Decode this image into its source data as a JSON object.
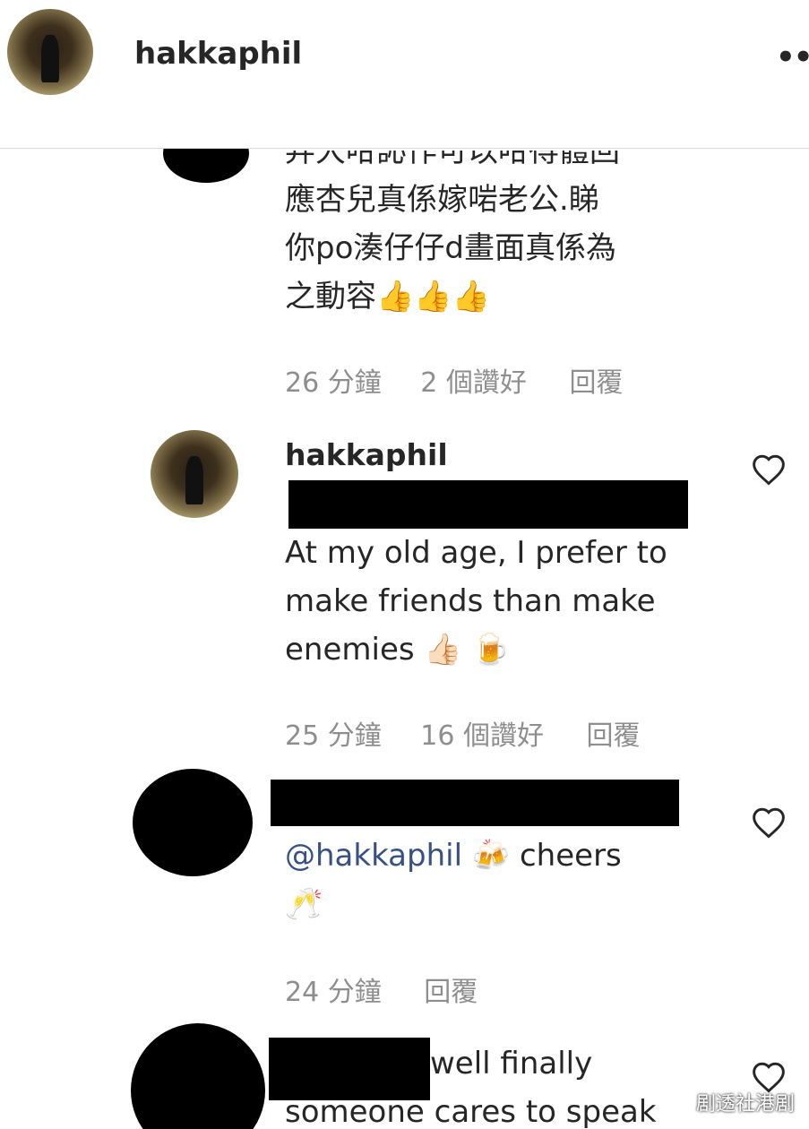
{
  "post_header": {
    "username": "hakkaphil",
    "more_icon": "•••"
  },
  "comments": [
    {
      "lines": [
        "弃大咁訫作可以咁得體回",
        "應杏兒真係嫁啱老公.睇",
        "你po湊仔仔d畫面真係為",
        "之動容👍👍👍"
      ],
      "time": "26 分鐘",
      "likes": "2 個讚好",
      "reply": "回覆"
    },
    {
      "username": "hakkaphil",
      "lines": [
        "At my old age, I prefer to",
        "make friends than make",
        "enemies 👍🏻 🍺"
      ],
      "time": "25 分鐘",
      "likes": "16 個讚好",
      "reply": "回覆"
    },
    {
      "mention": "@hakkaphil",
      "text_after_mention": "🍻 cheers",
      "line2": "🥂",
      "time": "24 分鐘",
      "reply": "回覆"
    },
    {
      "line1": "well finally",
      "line2": "someone cares to speak"
    }
  ],
  "watermark": "剧透社港剧",
  "colors": {
    "text": "#262626",
    "meta": "#8e8e8e",
    "mention": "#385185",
    "divider": "#dbdbdb"
  }
}
